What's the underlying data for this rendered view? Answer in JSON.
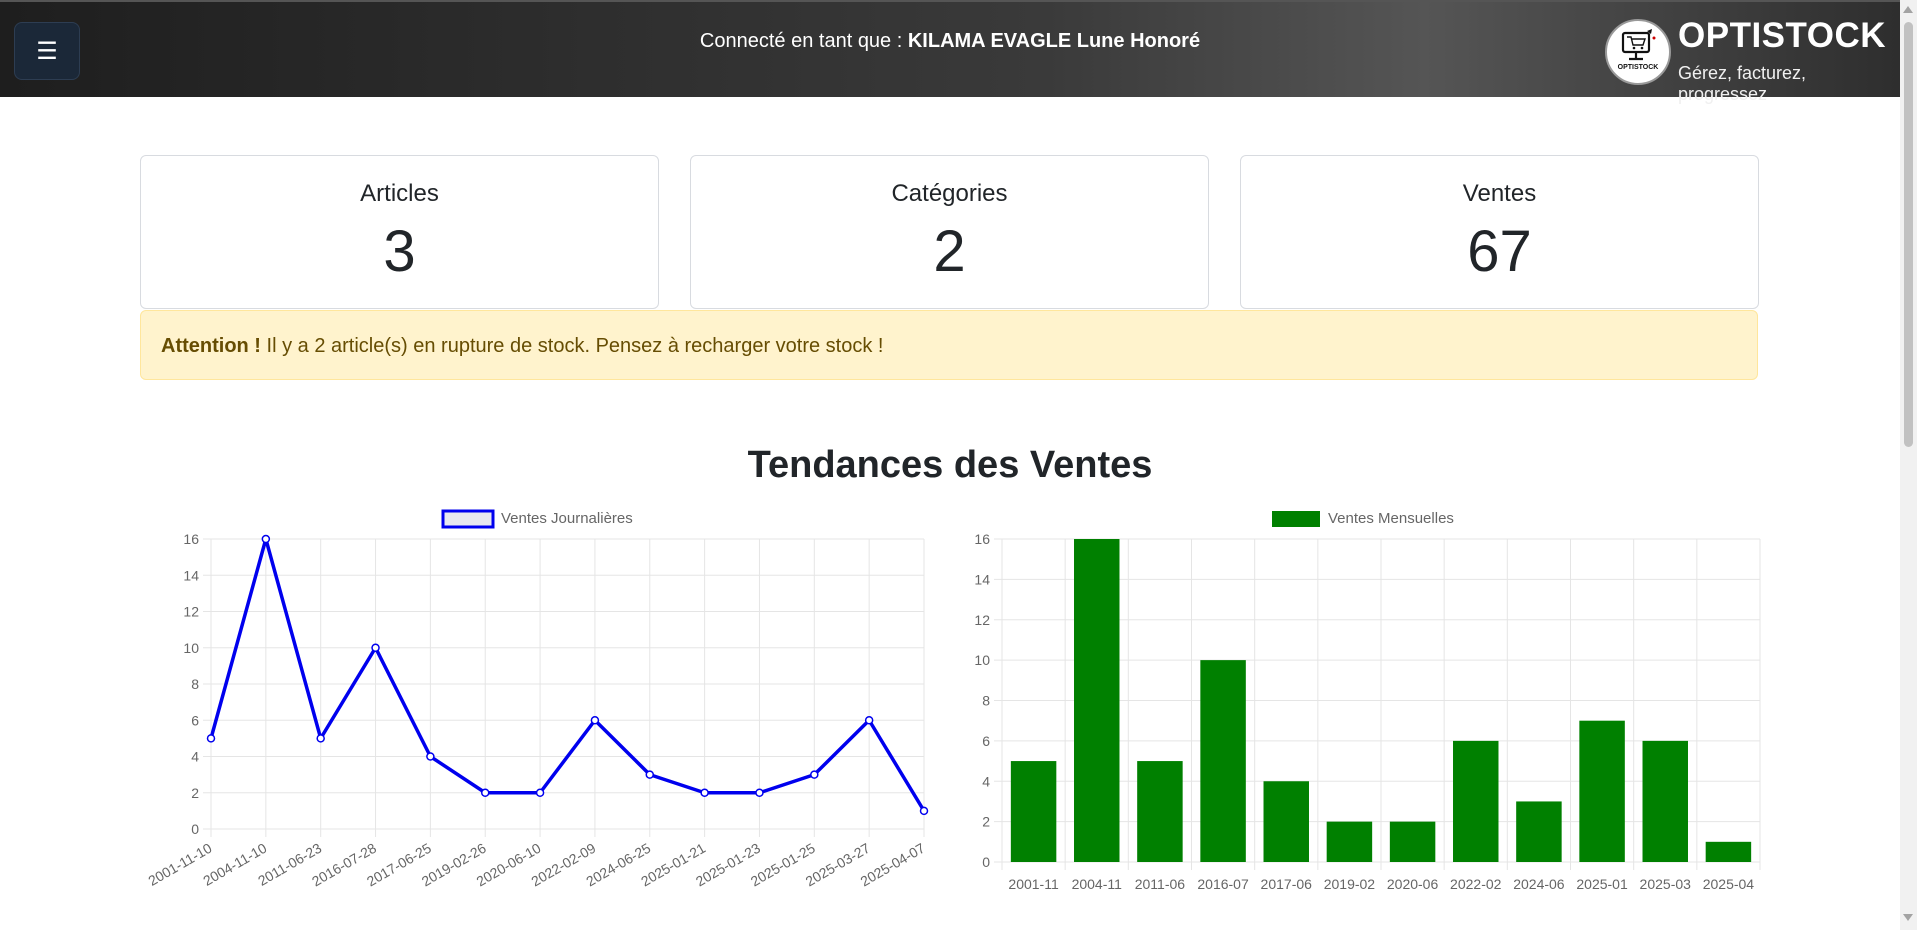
{
  "header": {
    "menu_icon": "☰",
    "login_prefix": "Connecté en tant que : ",
    "user_name": "KILAMA EVAGLE Lune Honoré",
    "brand_name": "OPTISTOCK",
    "brand_tagline": "Gérez, facturez, progressez",
    "logo_text": "OPTISTOCK"
  },
  "stats": [
    {
      "label": "Articles",
      "value": "3"
    },
    {
      "label": "Catégories",
      "value": "2"
    },
    {
      "label": "Ventes",
      "value": "67"
    }
  ],
  "alert": {
    "strong": "Attention !",
    "message": " Il y a 2 article(s) en rupture de stock. Pensez à recharger votre stock !"
  },
  "section": {
    "title": "Tendances des Ventes"
  },
  "chart_data": [
    {
      "type": "line",
      "legend": "Ventes Journalières",
      "color": "#0000ee",
      "x": [
        "2001-11-10",
        "2004-11-10",
        "2011-06-23",
        "2016-07-28",
        "2017-06-25",
        "2019-02-26",
        "2020-06-10",
        "2022-02-09",
        "2024-06-25",
        "2025-01-21",
        "2025-01-23",
        "2025-01-25",
        "2025-03-27",
        "2025-04-07"
      ],
      "values": [
        5,
        16,
        5,
        10,
        4,
        2,
        2,
        6,
        3,
        2,
        2,
        3,
        6,
        1
      ],
      "ylim": [
        0,
        16
      ],
      "yticks": [
        0,
        2,
        4,
        6,
        8,
        10,
        12,
        14,
        16
      ],
      "grid": true,
      "legend_position": "top"
    },
    {
      "type": "bar",
      "legend": "Ventes Mensuelles",
      "color": "#008000",
      "categories": [
        "2001-11",
        "2004-11",
        "2011-06",
        "2016-07",
        "2017-06",
        "2019-02",
        "2020-06",
        "2022-02",
        "2024-06",
        "2025-01",
        "2025-03",
        "2025-04"
      ],
      "values": [
        5,
        16,
        5,
        10,
        4,
        2,
        2,
        6,
        3,
        7,
        6,
        1
      ],
      "ylim": [
        0,
        16
      ],
      "yticks": [
        0,
        2,
        4,
        6,
        8,
        10,
        12,
        14,
        16
      ],
      "grid": true,
      "legend_position": "top"
    }
  ]
}
